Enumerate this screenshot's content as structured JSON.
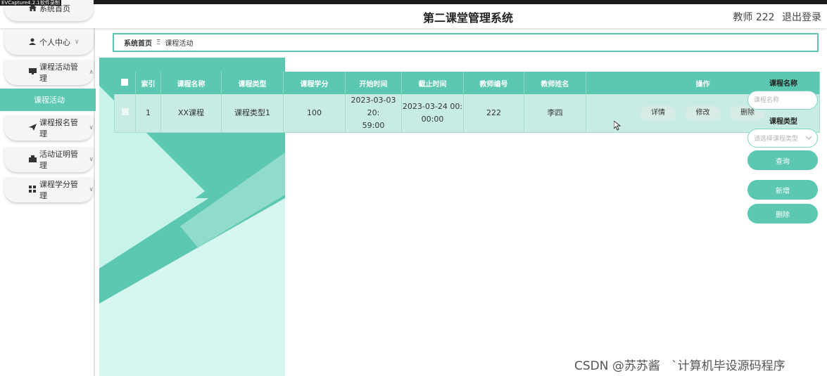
{
  "capture_tag": "EVCapture4.2.1软件录制",
  "header": {
    "title": "第二课堂管理系统",
    "user": "教师 222",
    "logout": "退出登录"
  },
  "sidebar": {
    "items": [
      {
        "label": "系统首页",
        "icon": "home-icon"
      },
      {
        "label": "个人中心",
        "icon": "user-icon",
        "chevron": "∨"
      },
      {
        "label": "课程活动管理",
        "icon": "monitor-icon",
        "chevron": "∧"
      },
      {
        "label": "课程报名管理",
        "icon": "send-icon",
        "chevron": "∨"
      },
      {
        "label": "活动证明管理",
        "icon": "certificate-icon",
        "chevron": "∨"
      },
      {
        "label": "课程学分管理",
        "icon": "grid-icon",
        "chevron": "∨"
      }
    ],
    "active_sub": "课程活动"
  },
  "breadcrumb": {
    "home": "系统首页",
    "separator": "Ξ",
    "current": "课程活动"
  },
  "table": {
    "headers": [
      "索引",
      "课程名称",
      "课程类型",
      "课程学分",
      "开始时间",
      "截止时间",
      "教师编号",
      "教师姓名",
      "操作"
    ],
    "rows": [
      {
        "index": "1",
        "name": "XX课程",
        "type": "课程类型1",
        "credit": "100",
        "start": "2023-03-03 20:59:00",
        "start_l1": "2023-03-03 20:",
        "start_l2": "59:00",
        "end": "2023-03-24 00:00:00",
        "end_l1": "2023-03-24 00:",
        "end_l2": "00:00",
        "teacher_no": "222",
        "teacher_name": "李四",
        "actions": [
          "详情",
          "修改",
          "删除"
        ]
      }
    ]
  },
  "search": {
    "name_label": "课程名称",
    "name_placeholder": "课程名称",
    "type_label": "课程类型",
    "type_placeholder": "请选择课程类型",
    "query_btn": "查询",
    "add_btn": "新增",
    "delete_btn": "删除"
  },
  "watermark": "CSDN @苏苏酱   `计算机毕设源码程序",
  "colors": {
    "accent": "#5cc8b1",
    "row_bg": "#c8ece3",
    "deco_dark": "#5cc8b1",
    "deco_light": "#c8f3e9"
  }
}
